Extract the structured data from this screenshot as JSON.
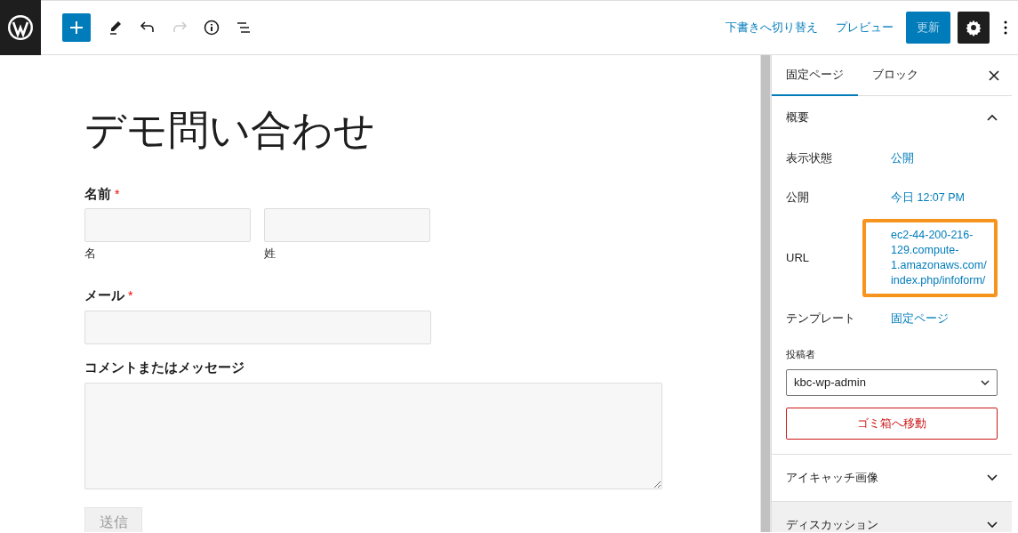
{
  "toolbar": {
    "tools": [
      {
        "kind": "add",
        "disabled": false
      },
      {
        "kind": "pen",
        "disabled": false
      },
      {
        "kind": "undo",
        "disabled": false
      },
      {
        "kind": "redo",
        "disabled": true
      },
      {
        "kind": "info",
        "disabled": false
      },
      {
        "kind": "list",
        "disabled": false
      }
    ],
    "links": [
      "下書きへ切り替え",
      "プレビュー"
    ],
    "update_button": "更新"
  },
  "page": {
    "title": "デモ問い合わせ",
    "fields": [
      {
        "kind": "name",
        "label": "名前",
        "required_mark": "*",
        "sublabels": [
          "名",
          "姓"
        ]
      },
      {
        "kind": "email",
        "label": "メール",
        "required_mark": "*"
      },
      {
        "kind": "textarea",
        "label": "コメントまたはメッセージ"
      }
    ],
    "submit": "送信"
  },
  "sidebar": {
    "tabs": [
      {
        "label": "固定ページ",
        "selected": true
      },
      {
        "label": "ブロック",
        "selected": false
      }
    ],
    "summary": {
      "title": "概要",
      "expanded": true,
      "rows": [
        {
          "label": "表示状態",
          "value": "公開",
          "highlighted": false
        },
        {
          "label": "公開",
          "value": "今日 12:07 PM",
          "highlighted": false
        },
        {
          "label": "URL",
          "value": "ec2-44-200-216-129.compute-1.amazonaws.com/index.php/infoform/",
          "highlighted": true
        },
        {
          "label": "テンプレート",
          "value": "固定ページ",
          "highlighted": false
        }
      ],
      "author_label": "投稿者",
      "author": "kbc-wp-admin",
      "trash_button": "ゴミ箱へ移動"
    },
    "panels": [
      {
        "title": "アイキャッチ画像",
        "expanded": false,
        "hovered": false
      },
      {
        "title": "ディスカッション",
        "expanded": false,
        "hovered": true
      }
    ]
  }
}
